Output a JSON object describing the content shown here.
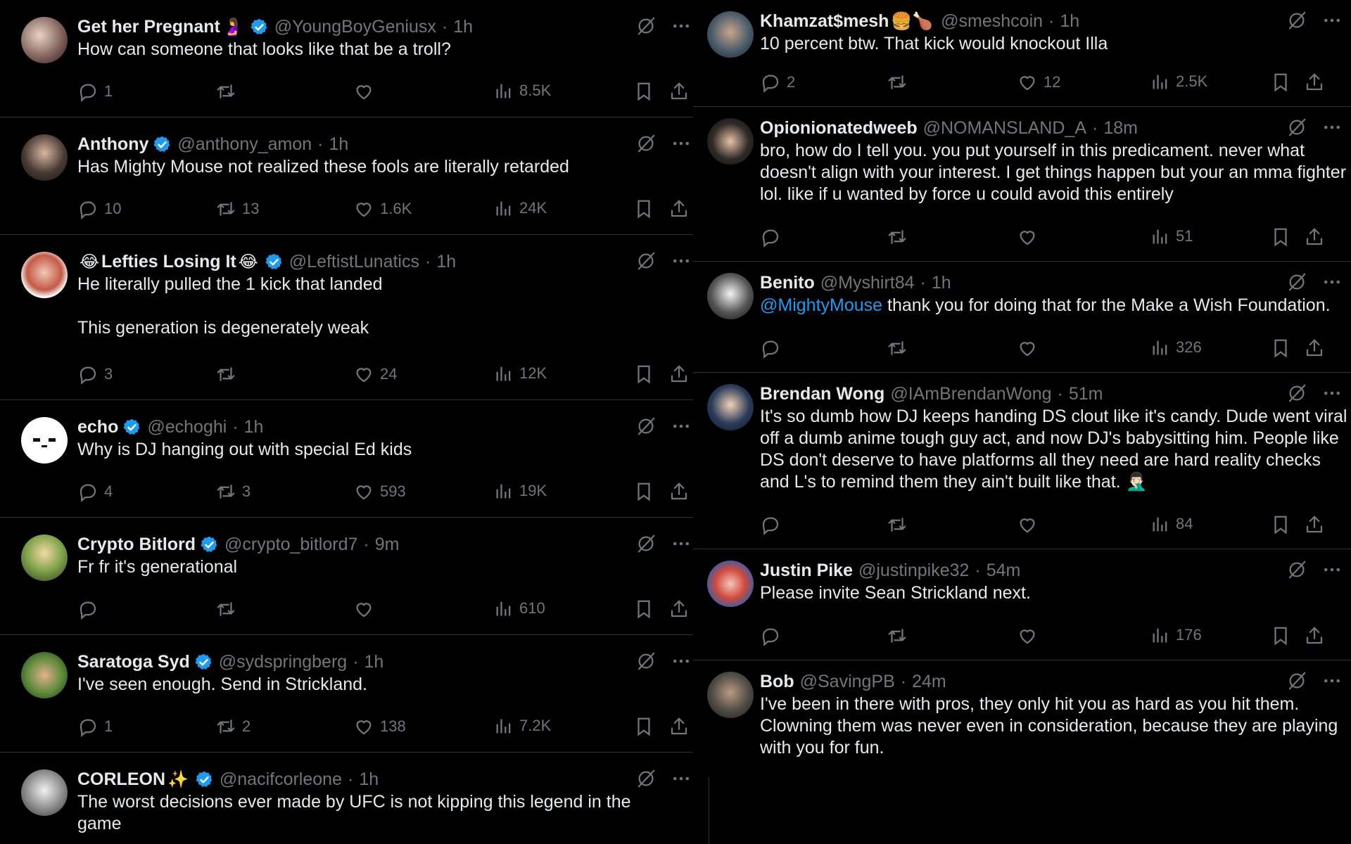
{
  "left_tweets": [
    {
      "name": "Get her Pregnant",
      "name_emoji": "🤰",
      "verified": true,
      "handle": "@YoungBoyGeniusx",
      "time": "1h",
      "text": "How can someone that looks like that be a troll?",
      "replies": "1",
      "retweets": "",
      "likes": "",
      "views": "8.5K"
    },
    {
      "name": "Anthony",
      "verified": true,
      "handle": "@anthony_amon",
      "time": "1h",
      "text": "Has Mighty Mouse not realized these fools are literally retarded",
      "replies": "10",
      "retweets": "13",
      "likes": "1.6K",
      "views": "24K"
    },
    {
      "name_prefix_emoji": "😂",
      "name": "Lefties Losing It",
      "name_emoji": "😂",
      "verified": true,
      "handle": "@LeftistLunatics",
      "time": "1h",
      "text": "He literally pulled the 1 kick that landed\n\nThis generation is degenerately weak",
      "replies": "3",
      "retweets": "",
      "likes": "24",
      "views": "12K"
    },
    {
      "name": "echo",
      "verified": true,
      "handle": "@echoghi",
      "time": "1h",
      "text": "Why is DJ hanging out with special Ed kids",
      "replies": "4",
      "retweets": "3",
      "likes": "593",
      "views": "19K"
    },
    {
      "name": "Crypto Bitlord",
      "verified": true,
      "handle": "@crypto_bitlord7",
      "time": "9m",
      "text": "Fr fr it's generational",
      "replies": "",
      "retweets": "",
      "likes": "",
      "views": "610"
    },
    {
      "name": "Saratoga Syd",
      "verified": true,
      "handle": "@sydspringberg",
      "time": "1h",
      "text": "I've seen enough. Send in Strickland.",
      "replies": "1",
      "retweets": "2",
      "likes": "138",
      "views": "7.2K"
    },
    {
      "name": "CORLEON",
      "name_emoji": "✨",
      "verified": true,
      "handle": "@nacifcorleone",
      "time": "1h",
      "text": "The worst decisions ever made by UFC is not kipping this legend in the\ngame",
      "replies": "",
      "retweets": "",
      "likes": "",
      "views": ""
    }
  ],
  "right_tweets": [
    {
      "name": "Khamzat$mesh",
      "name_emoji": "🍔🍗",
      "verified": false,
      "handle": "@smeshcoin",
      "time": "1h",
      "text": "10 percent btw. That kick would knockout Illa",
      "replies": "2",
      "retweets": "",
      "likes": "12",
      "views": "2.5K"
    },
    {
      "name": "Opionionatedweeb",
      "verified": false,
      "handle": "@NOMANSLAND_A",
      "time": "18m",
      "text": "bro, how do I tell you. you put yourself in this predicament. never what\ndoesn't align with your interest. I get things happen but your an mma fighter\nlol. like if u wanted by force u could avoid this entirely",
      "replies": "",
      "retweets": "",
      "likes": "",
      "views": "51"
    },
    {
      "name": "Benito",
      "verified": false,
      "handle": "@Myshirt84",
      "time": "1h",
      "mention": "@MightyMouse",
      "text": " thank you for doing that for the Make a Wish Foundation.",
      "replies": "",
      "retweets": "",
      "likes": "",
      "views": "326"
    },
    {
      "name": "Brendan Wong",
      "verified": false,
      "handle": "@IAmBrendanWong",
      "time": "51m",
      "text": "It's so dumb how DJ keeps handing DS clout like it's candy. Dude went viral\noff a dumb anime tough guy act, and now DJ's babysitting him. People like\nDS don't deserve to have platforms all they need are hard reality checks\nand L's to remind them they ain't built like that. 🤦🏻‍♂️",
      "replies": "",
      "retweets": "",
      "likes": "",
      "views": "84"
    },
    {
      "name": "Justin Pike",
      "verified": false,
      "handle": "@justinpike32",
      "time": "54m",
      "text": "Please invite Sean Strickland next.",
      "replies": "",
      "retweets": "",
      "likes": "",
      "views": "176"
    },
    {
      "name": "Bob",
      "verified": false,
      "handle": "@SavingPB",
      "time": "24m",
      "text": "I've been in there with pros, they only hit you as hard as you hit them.\nClowning them was never even in consideration, because they are playing\nwith you for fun.",
      "replies": "",
      "retweets": "",
      "likes": "",
      "views": ""
    }
  ],
  "colors": {
    "background": "#000000",
    "text": "#e7e9ea",
    "muted": "#71767b",
    "accent": "#1d9bf0",
    "border": "#2f3336"
  },
  "icons": {
    "reply": "reply-icon",
    "retweet": "retweet-icon",
    "like": "heart-icon",
    "views": "views-icon",
    "bookmark": "bookmark-icon",
    "share": "share-icon",
    "grok": "grok-icon",
    "more": "more-icon",
    "verified": "verified-badge-icon"
  }
}
